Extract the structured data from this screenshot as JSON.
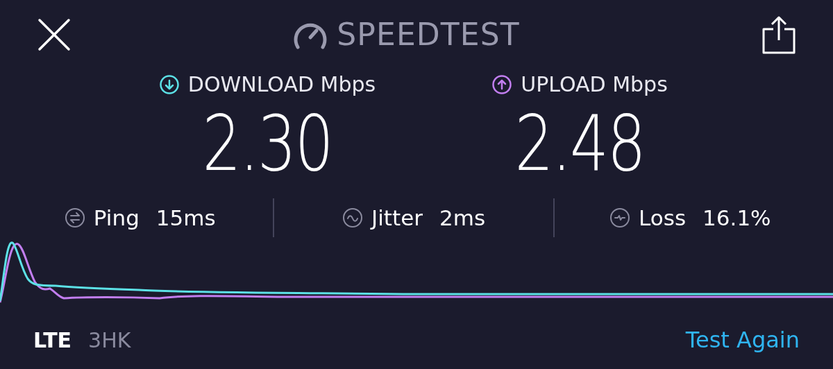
{
  "header": {
    "title": "SPEEDTEST"
  },
  "results": [
    {
      "kind": "download",
      "label": "DOWNLOAD Mbps",
      "value": "2.30",
      "color": "#5ce1e6"
    },
    {
      "kind": "upload",
      "label": "UPLOAD Mbps",
      "value": "2.48",
      "color": "#c27ef0"
    }
  ],
  "metrics": [
    {
      "kind": "ping",
      "label": "Ping",
      "value": "15ms"
    },
    {
      "kind": "jitter",
      "label": "Jitter",
      "value": "2ms"
    },
    {
      "kind": "loss",
      "label": "Loss",
      "value": "16.1%"
    }
  ],
  "footer": {
    "network": "LTE",
    "carrier": "3HK",
    "action": "Test Again"
  }
}
